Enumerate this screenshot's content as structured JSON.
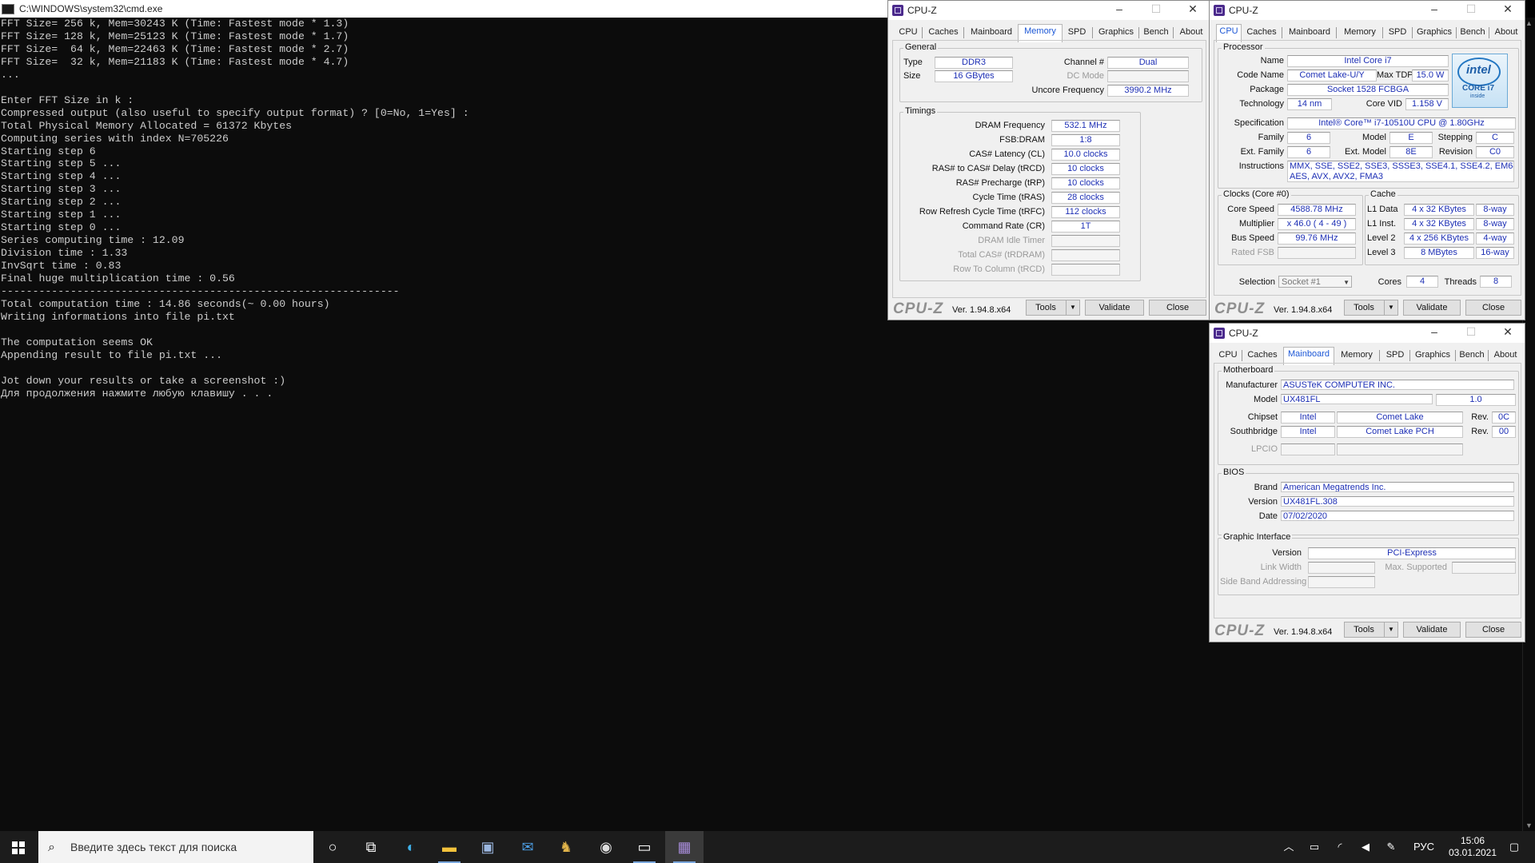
{
  "console": {
    "title": "C:\\WINDOWS\\system32\\cmd.exe",
    "lines": [
      "FFT Size= 256 k, Mem=30243 K (Time: Fastest mode * 1.3)",
      "FFT Size= 128 k, Mem=25123 K (Time: Fastest mode * 1.7)",
      "FFT Size=  64 k, Mem=22463 K (Time: Fastest mode * 2.7)",
      "FFT Size=  32 k, Mem=21183 K (Time: Fastest mode * 4.7)",
      "...",
      "",
      "Enter FFT Size in k :",
      "Compressed output (also useful to specify output format) ? [0=No, 1=Yes] :",
      "Total Physical Memory Allocated = 61372 Kbytes",
      "Computing series with index N=705226",
      "Starting step 6",
      "Starting step 5 ...",
      "Starting step 4 ...",
      "Starting step 3 ...",
      "Starting step 2 ...",
      "Starting step 1 ...",
      "Starting step 0 ...",
      "Series computing time : 12.09",
      "Division time : 1.33",
      "InvSqrt time : 0.83",
      "Final huge multiplication time : 0.56",
      "---------------------------------------------------------------",
      "Total computation time : 14.86 seconds(~ 0.00 hours)",
      "Writing informations into file pi.txt",
      "",
      "The computation seems OK",
      "Appending result to file pi.txt ...",
      "",
      "Jot down your results or take a screenshot :)",
      "Для продолжения нажмите любую клавишу . . ."
    ]
  },
  "cpuz_common": {
    "title": "CPU-Z",
    "tabs": [
      "CPU",
      "Caches",
      "Mainboard",
      "Memory",
      "SPD",
      "Graphics",
      "Bench",
      "About"
    ],
    "brand": "CPU-Z",
    "version": "Ver. 1.94.8.x64",
    "tools": "Tools",
    "validate": "Validate",
    "close": "Close"
  },
  "memory": {
    "general_label": "General",
    "type_label": "Type",
    "type": "DDR3",
    "size_label": "Size",
    "size": "16 GBytes",
    "channel_label": "Channel #",
    "channel": "Dual",
    "dc_label": "DC Mode",
    "uncore_label": "Uncore Frequency",
    "uncore": "3990.2 MHz",
    "timings_label": "Timings",
    "timings": [
      {
        "label": "DRAM Frequency",
        "value": "532.1 MHz"
      },
      {
        "label": "FSB:DRAM",
        "value": "1:8"
      },
      {
        "label": "CAS# Latency (CL)",
        "value": "10.0 clocks"
      },
      {
        "label": "RAS# to CAS# Delay (tRCD)",
        "value": "10 clocks"
      },
      {
        "label": "RAS# Precharge (tRP)",
        "value": "10 clocks"
      },
      {
        "label": "Cycle Time (tRAS)",
        "value": "28 clocks"
      },
      {
        "label": "Row Refresh Cycle Time (tRFC)",
        "value": "112 clocks"
      },
      {
        "label": "Command Rate (CR)",
        "value": "1T"
      },
      {
        "label": "DRAM Idle Timer",
        "value": ""
      },
      {
        "label": "Total CAS# (tRDRAM)",
        "value": ""
      },
      {
        "label": "Row To Column (tRCD)",
        "value": ""
      }
    ]
  },
  "cpu": {
    "processor_label": "Processor",
    "name_label": "Name",
    "name": "Intel Core i7",
    "codename_label": "Code Name",
    "codename": "Comet Lake-U/Y",
    "tdp_label": "Max TDP",
    "tdp": "15.0 W",
    "package_label": "Package",
    "package": "Socket 1528 FCBGA",
    "tech_label": "Technology",
    "tech": "14 nm",
    "vid_label": "Core VID",
    "vid": "1.158 V",
    "spec_label": "Specification",
    "spec": "Intel® Core™ i7-10510U CPU @ 1.80GHz",
    "family_label": "Family",
    "family": "6",
    "model_label": "Model",
    "model": "E",
    "stepping_label": "Stepping",
    "stepping": "C",
    "extfamily_label": "Ext. Family",
    "extfamily": "6",
    "extmodel_label": "Ext. Model",
    "extmodel": "8E",
    "revision_label": "Revision",
    "revision": "C0",
    "instr_label": "Instructions",
    "instr1": "MMX, SSE, SSE2, SSE3, SSSE3, SSE4.1, SSE4.2, EM64T, VT-x,",
    "instr2": "AES, AVX, AVX2, FMA3",
    "clocks_label": "Clocks (Core #0)",
    "corespeed_label": "Core Speed",
    "corespeed": "4588.78 MHz",
    "mult_label": "Multiplier",
    "mult": "x 46.0 ( 4 - 49 )",
    "bus_label": "Bus Speed",
    "bus": "99.76 MHz",
    "fsb_label": "Rated FSB",
    "cache_label": "Cache",
    "l1d_label": "L1 Data",
    "l1d": "4 x 32 KBytes",
    "l1d_way": "8-way",
    "l1i_label": "L1 Inst.",
    "l1i": "4 x 32 KBytes",
    "l1i_way": "8-way",
    "l2_label": "Level 2",
    "l2": "4 x 256 KBytes",
    "l2_way": "4-way",
    "l3_label": "Level 3",
    "l3": "8 MBytes",
    "l3_way": "16-way",
    "selection_label": "Selection",
    "selection": "Socket #1",
    "cores_label": "Cores",
    "cores": "4",
    "threads_label": "Threads",
    "threads": "8",
    "logo_text": "intel",
    "logo_sub": "CORE i7",
    "logo_inside": "inside"
  },
  "mainboard": {
    "mb_label": "Motherboard",
    "manu_label": "Manufacturer",
    "manu": "ASUSTeK COMPUTER INC.",
    "model_label": "Model",
    "model": "UX481FL",
    "model_rev": "1.0",
    "chipset_label": "Chipset",
    "chipset_vendor": "Intel",
    "chipset": "Comet Lake",
    "rev_label": "Rev.",
    "chipset_rev": "0C",
    "south_label": "Southbridge",
    "south_vendor": "Intel",
    "south": "Comet Lake PCH",
    "south_rev": "00",
    "lpcio_label": "LPCIO",
    "bios_label": "BIOS",
    "brand_label": "Brand",
    "brand": "American Megatrends Inc.",
    "version_label": "Version",
    "version": "UX481FL.308",
    "date_label": "Date",
    "date": "07/02/2020",
    "gi_label": "Graphic Interface",
    "gi_version_label": "Version",
    "gi_version": "PCI-Express",
    "linkwidth_label": "Link Width",
    "maxsup_label": "Max. Supported",
    "sideband_label": "Side Band Addressing"
  },
  "taskbar": {
    "search_placeholder": "Введите здесь текст для поиска",
    "lang": "РУС",
    "time": "15:06",
    "date": "03.01.2021"
  }
}
